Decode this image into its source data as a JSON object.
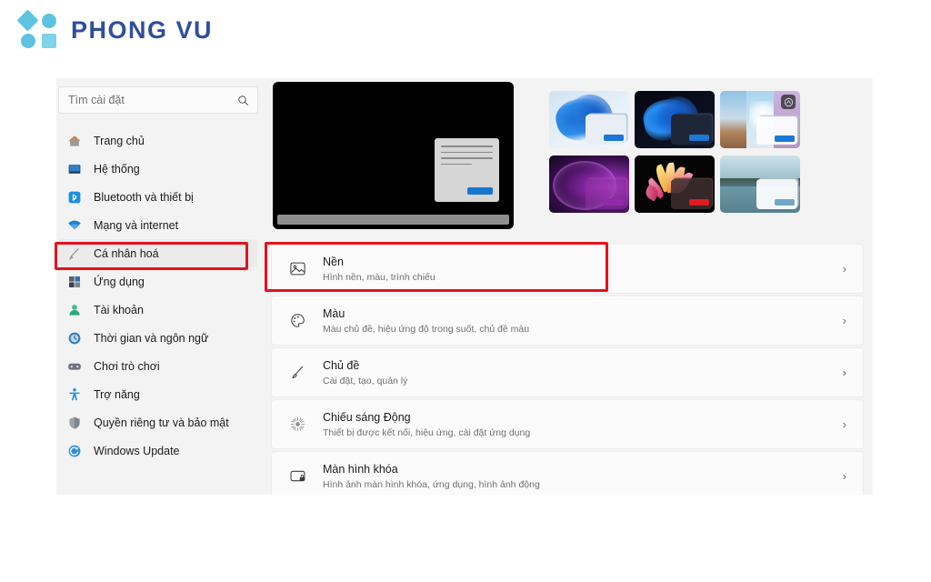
{
  "brand": {
    "name": "PHONG VU",
    "mark": [
      "diamond-shape",
      "circle-shape",
      "circle-shape",
      "square-shape"
    ],
    "color": "#2f4e9e",
    "accent": "#5ec3e0"
  },
  "search": {
    "placeholder": "Tìm cài đặt",
    "value": "",
    "icon": "search-icon"
  },
  "sidebar": {
    "items": [
      {
        "label": "Trang chủ",
        "icon": "home-icon",
        "active": false
      },
      {
        "label": "Hệ thống",
        "icon": "monitor-icon",
        "active": false
      },
      {
        "label": "Bluetooth và thiết bị",
        "icon": "bluetooth-icon",
        "active": false
      },
      {
        "label": "Mạng và internet",
        "icon": "wifi-icon",
        "active": false
      },
      {
        "label": "Cá nhân hoá",
        "icon": "paintbrush-icon",
        "active": true
      },
      {
        "label": "Ứng dụng",
        "icon": "apps-icon",
        "active": false
      },
      {
        "label": "Tài khoản",
        "icon": "account-icon",
        "active": false
      },
      {
        "label": "Thời gian và ngôn ngữ",
        "icon": "clock-icon",
        "active": false
      },
      {
        "label": "Chơi trò chơi",
        "icon": "gamepad-icon",
        "active": false
      },
      {
        "label": "Trợ năng",
        "icon": "accessibility-icon",
        "active": false
      },
      {
        "label": "Quyền riêng tư và bảo mật",
        "icon": "shield-icon",
        "active": false
      },
      {
        "label": "Windows Update",
        "icon": "update-icon",
        "active": false
      }
    ]
  },
  "main": {
    "monitor_preview": {
      "name": "desktop-preview",
      "screen_color": "#000000",
      "taskbar_color": "#8e8e8e",
      "dialog_button_color": "#1677d2"
    },
    "themes": [
      {
        "name": "theme-windows-light-bloom",
        "accent": "#1c78d4"
      },
      {
        "name": "theme-windows-dark-bloom",
        "accent": "#1c78d4"
      },
      {
        "name": "theme-spotlight-collage",
        "accent": "#1c78d4",
        "badge": "windows-spotlight-icon"
      },
      {
        "name": "theme-purple-glow",
        "accent": "#8f2aa8"
      },
      {
        "name": "theme-flower-dark",
        "accent": "#e01b24"
      },
      {
        "name": "theme-lake-landscape",
        "accent": "#6ea8c6"
      }
    ],
    "rows": [
      {
        "title": "Nền",
        "subtitle": "Hình nền, màu, trình chiếu",
        "icon": "picture-icon",
        "chevron": "›",
        "highlighted": true
      },
      {
        "title": "Màu",
        "subtitle": "Màu chủ đề, hiệu ứng độ trong suốt, chủ đề màu",
        "icon": "palette-icon",
        "chevron": "›",
        "highlighted": false
      },
      {
        "title": "Chủ đề",
        "subtitle": "Cài đặt, tạo, quản lý",
        "icon": "paintbrush-icon",
        "chevron": "›",
        "highlighted": false
      },
      {
        "title": "Chiếu sáng Động",
        "subtitle": "Thiết bị được kết nối, hiệu ứng, cài đặt ứng dụng",
        "icon": "sparkle-icon",
        "chevron": "›",
        "highlighted": false
      },
      {
        "title": "Màn hình khóa",
        "subtitle": "Hình ảnh màn hình khóa, ứng dụng, hình ảnh động",
        "icon": "lockscreen-icon",
        "chevron": "›",
        "highlighted": false
      }
    ]
  },
  "annotations": {
    "color": "#e3121c",
    "boxes": [
      {
        "name": "highlight-sidebar-personalization",
        "target": "Cá nhân hoá"
      },
      {
        "name": "highlight-row-background",
        "target": "Nền"
      }
    ]
  }
}
